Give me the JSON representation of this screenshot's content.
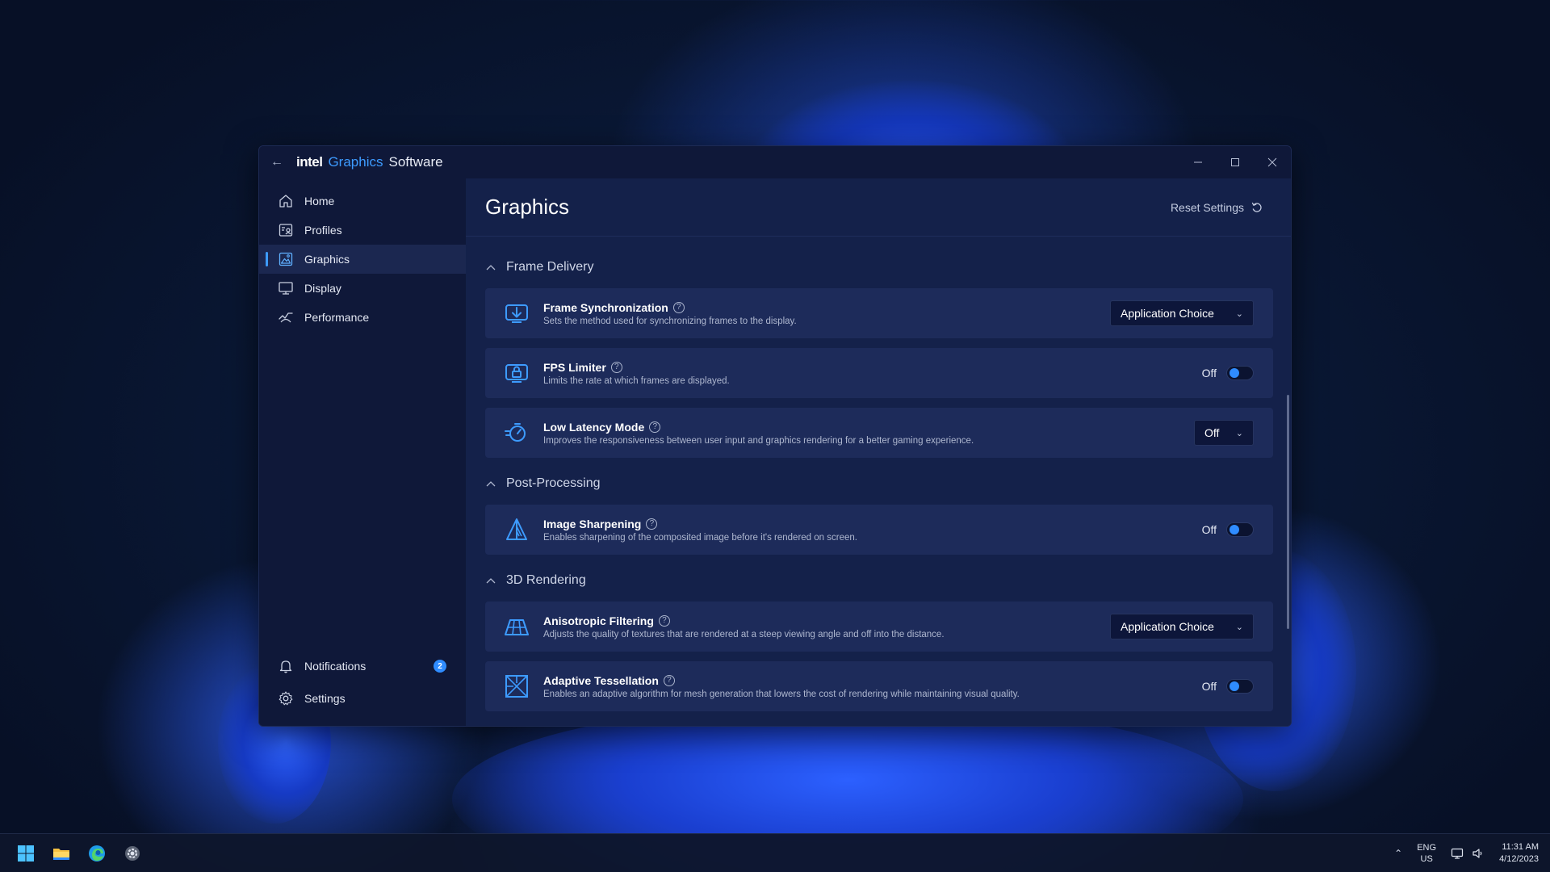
{
  "app": {
    "brand_intel": "intel",
    "brand_graphics": "Graphics",
    "brand_software": "Software"
  },
  "sidebar": {
    "items": [
      {
        "label": "Home",
        "icon": "home-icon"
      },
      {
        "label": "Profiles",
        "icon": "profiles-icon"
      },
      {
        "label": "Graphics",
        "icon": "graphics-icon",
        "active": true
      },
      {
        "label": "Display",
        "icon": "display-icon"
      },
      {
        "label": "Performance",
        "icon": "performance-icon"
      }
    ],
    "bottom": {
      "notifications_label": "Notifications",
      "notifications_count": "2",
      "settings_label": "Settings"
    }
  },
  "header": {
    "title": "Graphics",
    "reset_label": "Reset Settings"
  },
  "sections": {
    "frame_delivery": {
      "title": "Frame Delivery",
      "frame_sync": {
        "title": "Frame Synchronization",
        "desc": "Sets the method used for synchronizing frames to the display.",
        "value": "Application Choice"
      },
      "fps_limiter": {
        "title": "FPS Limiter",
        "desc": "Limits the rate at which frames are displayed.",
        "state": "Off"
      },
      "low_latency": {
        "title": "Low Latency Mode",
        "desc": "Improves the responsiveness between user input and graphics rendering for a better gaming experience.",
        "value": "Off"
      }
    },
    "post_processing": {
      "title": "Post-Processing",
      "image_sharpening": {
        "title": "Image Sharpening",
        "desc": "Enables sharpening of the composited image before it's rendered on screen.",
        "state": "Off"
      }
    },
    "rendering_3d": {
      "title": "3D Rendering",
      "anisotropic": {
        "title": "Anisotropic Filtering",
        "desc": "Adjusts the quality of textures that are rendered at a steep viewing angle and off into the distance.",
        "value": "Application Choice"
      },
      "tessellation": {
        "title": "Adaptive Tessellation",
        "desc": "Enables an adaptive algorithm for mesh generation that lowers the cost of rendering while maintaining visual quality.",
        "state": "Off"
      }
    }
  },
  "taskbar": {
    "apps": [
      "windows-start-icon",
      "file-explorer-icon",
      "edge-browser-icon",
      "settings-gear-icon"
    ],
    "lang_top": "ENG",
    "lang_bottom": "US",
    "time": "11:31 AM",
    "date": "4/12/2023"
  },
  "colors": {
    "accent": "#3d9bff",
    "toggle_knob": "#2f8cff",
    "content_bg": "#14214a",
    "card_bg": "#1d2b5a",
    "sidebar_bg": "#0f1839"
  }
}
